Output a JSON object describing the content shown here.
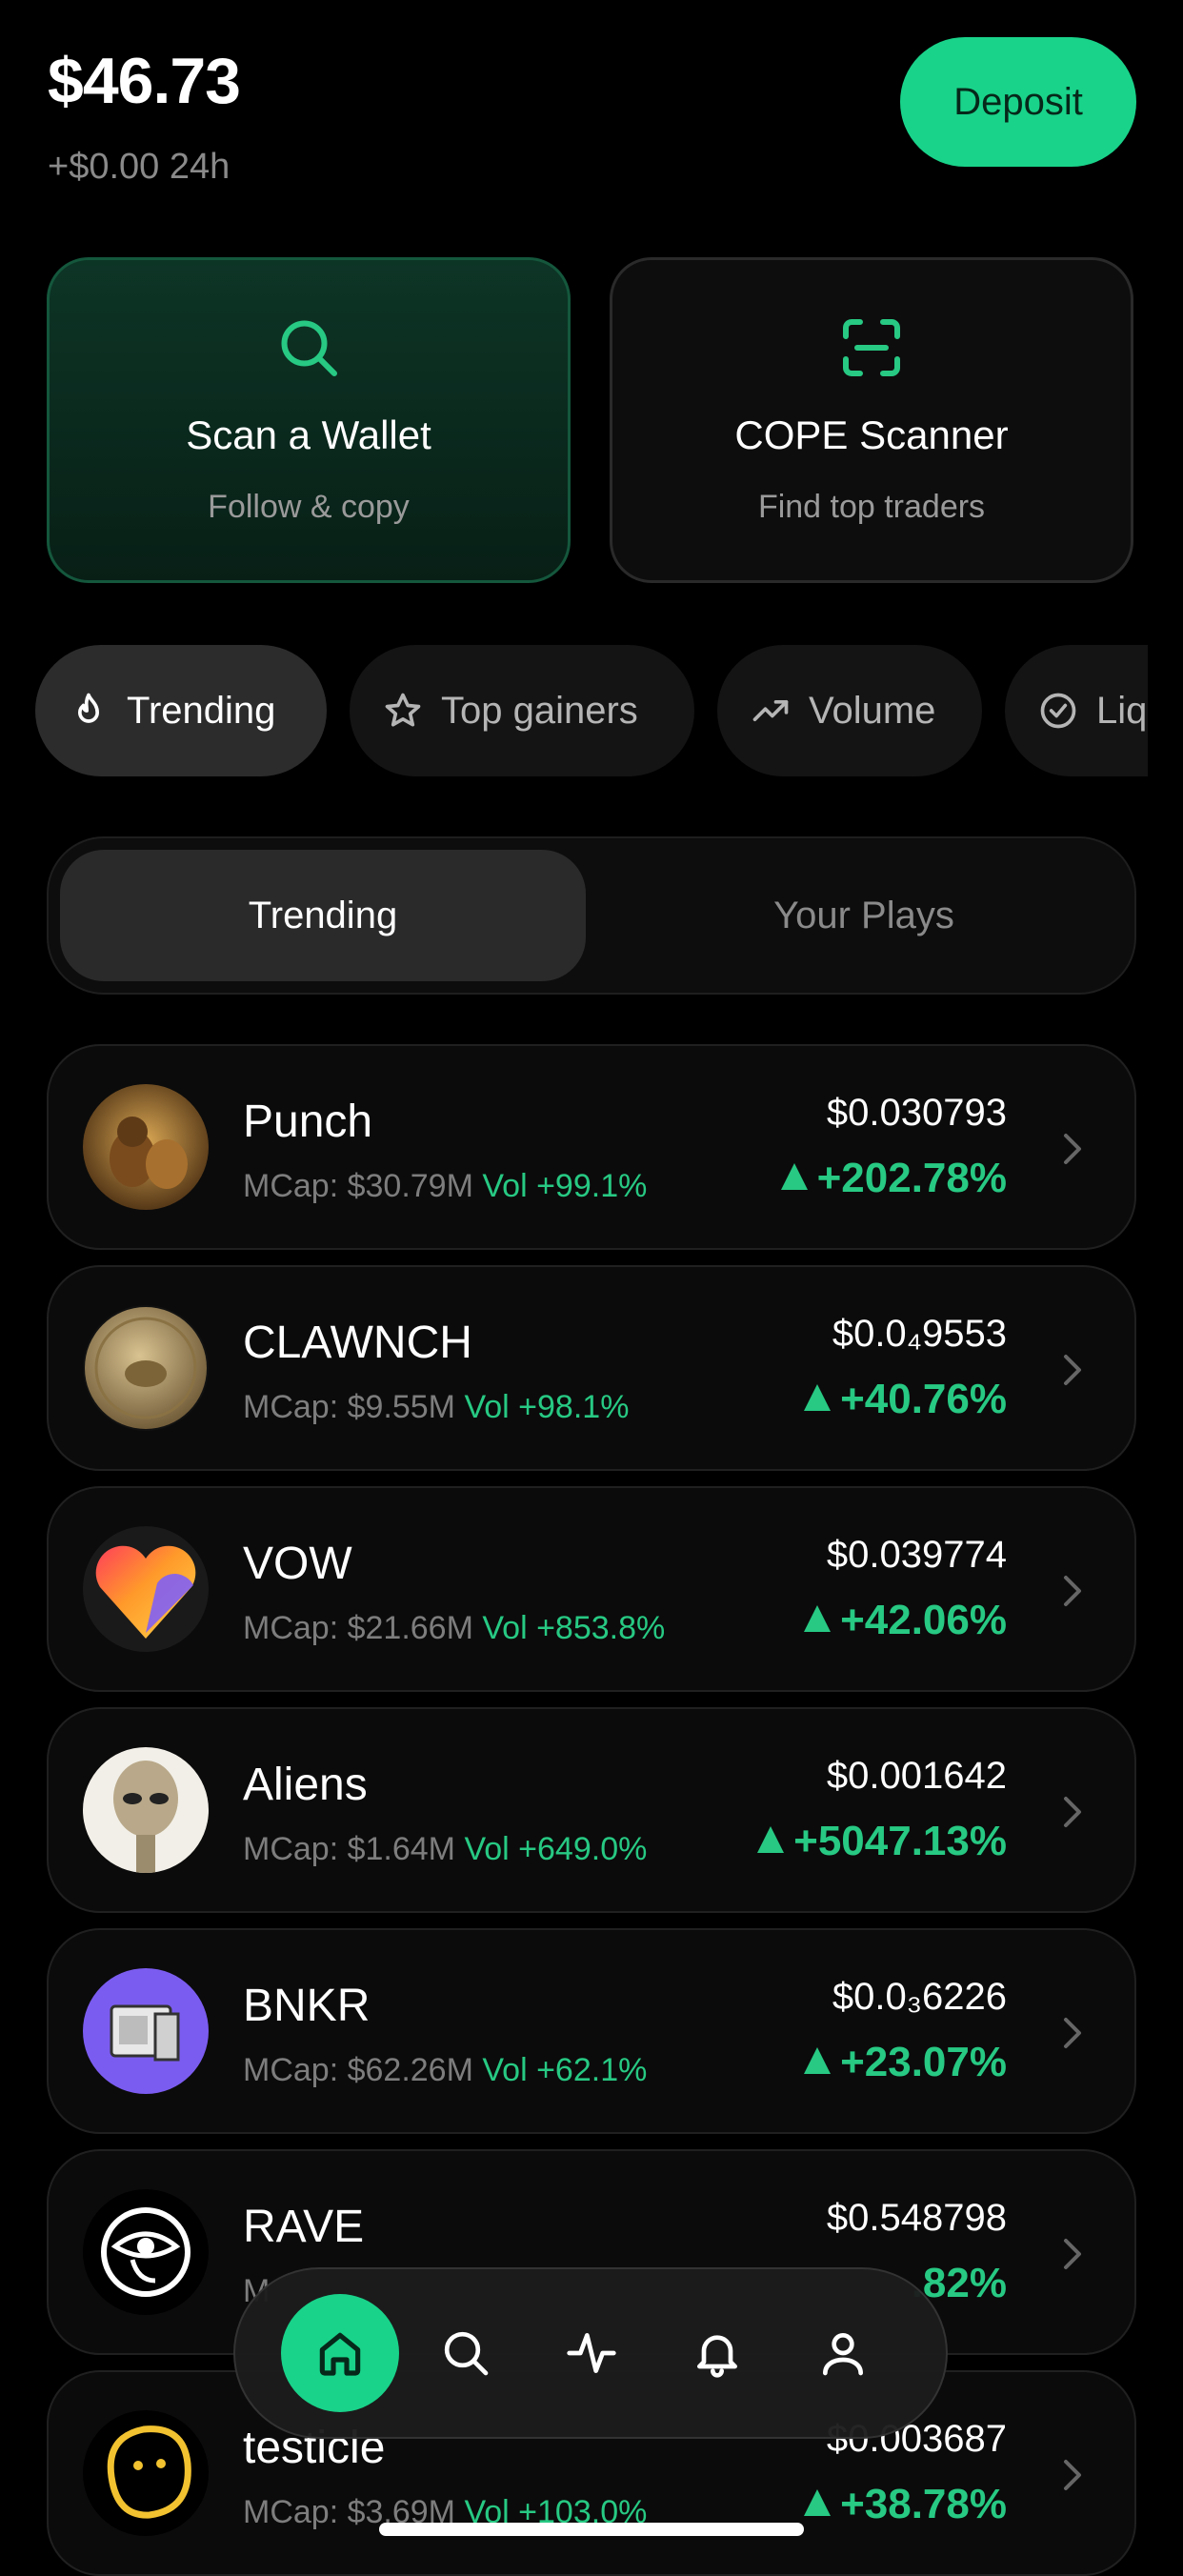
{
  "header": {
    "balance": "$46.73",
    "change_24h": "+$0.00 24h",
    "deposit_label": "Deposit"
  },
  "tools": [
    {
      "title": "Scan a Wallet",
      "subtitle": "Follow & copy",
      "icon": "search-icon"
    },
    {
      "title": "COPE Scanner",
      "subtitle": "Find top traders",
      "icon": "scan-icon"
    }
  ],
  "filters": [
    {
      "label": "Trending",
      "icon": "flame-icon",
      "active": true
    },
    {
      "label": "Top gainers",
      "icon": "star-icon",
      "active": false
    },
    {
      "label": "Volume",
      "icon": "trend-up-icon",
      "active": false
    },
    {
      "label": "Liq",
      "icon": "check-badge-icon",
      "active": false
    }
  ],
  "segment": {
    "active": "Trending",
    "other": "Your Plays"
  },
  "tokens": [
    {
      "name": "Punch",
      "mcap": "MCap: $30.79M",
      "vol": "Vol +99.1%",
      "price": "$0.030793",
      "change": "+202.78%"
    },
    {
      "name": "CLAWNCH",
      "mcap": "MCap: $9.55M",
      "vol": "Vol +98.1%",
      "price": "$0.0₄9553",
      "change": "+40.76%"
    },
    {
      "name": "VOW",
      "mcap": "MCap: $21.66M",
      "vol": "Vol +853.8%",
      "price": "$0.039774",
      "change": "+42.06%"
    },
    {
      "name": "Aliens",
      "mcap": "MCap: $1.64M",
      "vol": "Vol +649.0%",
      "price": "$0.001642",
      "change": "+5047.13%"
    },
    {
      "name": "BNKR",
      "mcap": "MCap: $62.26M",
      "vol": "Vol +62.1%",
      "price": "$0.0₃6226",
      "change": "+23.07%"
    },
    {
      "name": "RAVE",
      "mcap": "M",
      "vol": "",
      "price": "$0.548798",
      "change": ".82%"
    },
    {
      "name": "testicle",
      "mcap": "MCap: $3.69M",
      "vol": "Vol +103.0%",
      "price": "$0.003687",
      "change": "+38.78%"
    }
  ],
  "nav": [
    {
      "icon": "home-icon",
      "active": true
    },
    {
      "icon": "search-icon",
      "active": false
    },
    {
      "icon": "activity-icon",
      "active": false
    },
    {
      "icon": "bell-icon",
      "active": false
    },
    {
      "icon": "user-icon",
      "active": false
    }
  ],
  "colors": {
    "accent": "#19d38a",
    "positive": "#27c983",
    "background": "#000000"
  }
}
